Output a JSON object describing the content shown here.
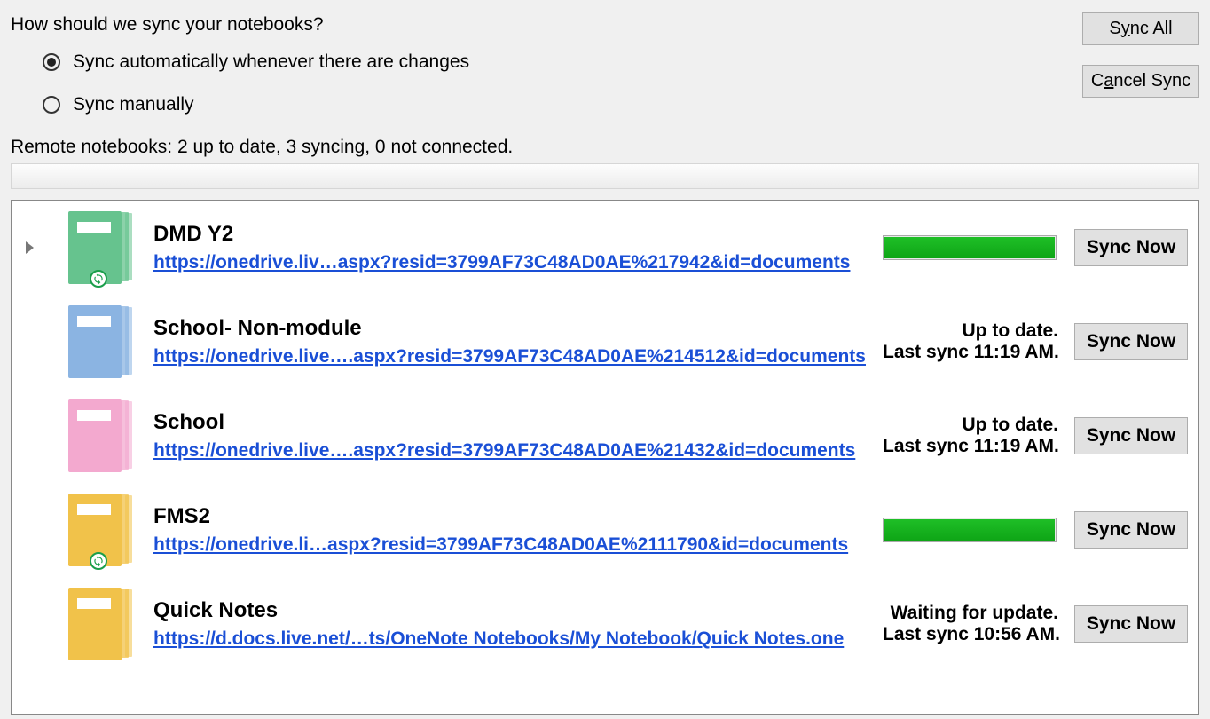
{
  "heading": "How should we sync your notebooks?",
  "radios": {
    "auto_label": "Sync automatically whenever there are changes",
    "manual_label": "Sync manually",
    "selected": "auto"
  },
  "buttons": {
    "sync_all_pre": "S",
    "sync_all_mn": "y",
    "sync_all_post": "nc All",
    "cancel_pre": "C",
    "cancel_mn": "a",
    "cancel_post": "ncel Sync",
    "sync_now": "Sync Now"
  },
  "summary": "Remote notebooks: 2 up to date, 3 syncing, 0 not connected.",
  "notebooks": [
    {
      "title": "DMD Y2",
      "link": "https://onedrive.liv…aspx?resid=3799AF73C48AD0AE%217942&id=documents",
      "color": "#66c38e",
      "syncing": true,
      "status1": "",
      "status2": ""
    },
    {
      "title": "School- Non-module",
      "link": "https://onedrive.live….aspx?resid=3799AF73C48AD0AE%214512&id=documents",
      "color": "#8bb4e2",
      "syncing": false,
      "status1": "Up to date.",
      "status2": "Last sync 11:19 AM."
    },
    {
      "title": "School",
      "link": "https://onedrive.live….aspx?resid=3799AF73C48AD0AE%21432&id=documents",
      "color": "#f3a9cf",
      "syncing": false,
      "status1": "Up to date.",
      "status2": "Last sync 11:19 AM."
    },
    {
      "title": "FMS2",
      "link": "https://onedrive.li…aspx?resid=3799AF73C48AD0AE%2111790&id=documents",
      "color": "#f1c24a",
      "syncing": true,
      "status1": "",
      "status2": ""
    },
    {
      "title": "Quick Notes",
      "link": "https://d.docs.live.net/…ts/OneNote Notebooks/My Notebook/Quick Notes.one",
      "color": "#f1c24a",
      "syncing": false,
      "status1": "Waiting for update.",
      "status2": "Last sync 10:56 AM."
    }
  ]
}
